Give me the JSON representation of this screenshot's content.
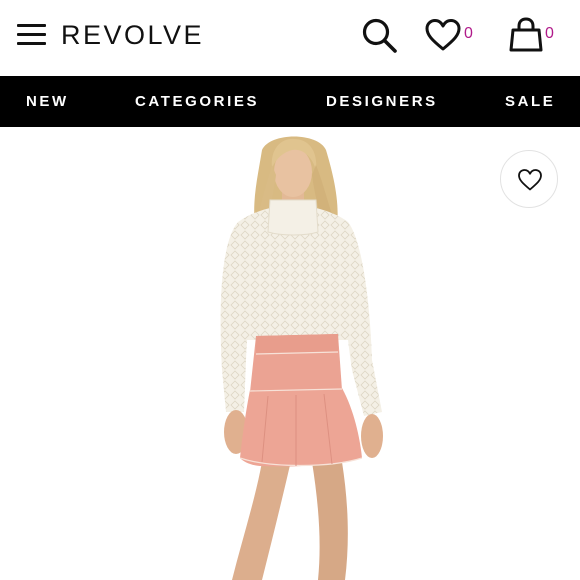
{
  "header": {
    "logo": "REVOLVE",
    "wishlist_count": "0",
    "cart_count": "0"
  },
  "nav": {
    "items": [
      {
        "label": "NEW"
      },
      {
        "label": "CATEGORIES"
      },
      {
        "label": "DESIGNERS"
      },
      {
        "label": "SALE"
      }
    ]
  },
  "colors": {
    "nav_background": "#000000",
    "count_accent": "#b01a8a",
    "sweater": "#f3efe4",
    "skirt": "#eba393"
  },
  "icons": [
    "menu-icon",
    "search-icon",
    "heart-icon",
    "bag-icon",
    "wishlist-heart-icon"
  ]
}
